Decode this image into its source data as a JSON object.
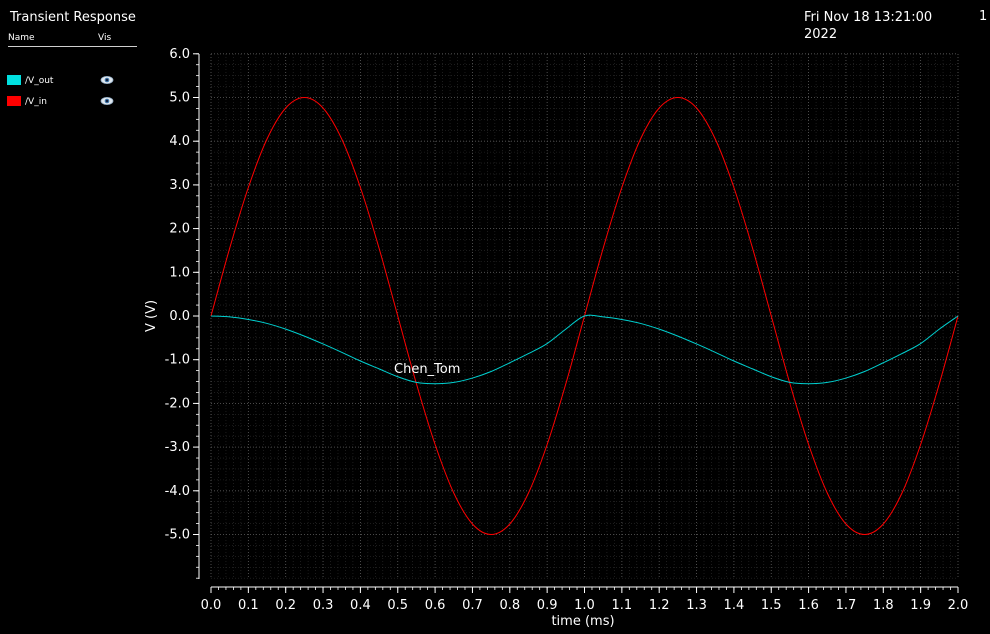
{
  "window": {
    "title": "Transient Response",
    "datetime": "Fri Nov 18 13:21:00 2022",
    "page_number": "1"
  },
  "legend": {
    "name_header": "Name",
    "vis_header": "Vis",
    "items": [
      {
        "label": "/V_out",
        "color": "#00e0e0",
        "eye_icon": "eye-icon"
      },
      {
        "label": "/V_in",
        "color": "#ff0000",
        "eye_icon": "eye-icon"
      }
    ]
  },
  "chart_data": {
    "type": "line",
    "title": "Transient Response",
    "xlabel": "time (ms)",
    "ylabel": "V (V)",
    "xlim": [
      0.0,
      2.0
    ],
    "ylim": [
      -6.0,
      6.0
    ],
    "x_ticks": [
      0.0,
      0.1,
      0.2,
      0.3,
      0.4,
      0.5,
      0.6,
      0.7,
      0.8,
      0.9,
      1.0,
      1.1,
      1.2,
      1.3,
      1.4,
      1.5,
      1.6,
      1.7,
      1.8,
      1.9,
      2.0
    ],
    "x_tick_labels": [
      "0.0",
      "0.1",
      "0.2",
      "0.3",
      "0.4",
      "0.5",
      "0.6",
      "0.7",
      "0.8",
      "0.9",
      "1.0",
      "1.1",
      "1.2",
      "1.3",
      "1.4",
      "1.5",
      "1.6",
      "1.7",
      "1.8",
      "1.9",
      "2.0"
    ],
    "y_ticks": [
      6.0,
      5.0,
      4.0,
      3.0,
      2.0,
      1.0,
      0.0,
      -1.0,
      -2.0,
      -3.0,
      -4.0,
      -5.0
    ],
    "y_tick_labels": [
      "6.0",
      "5.0",
      "4.0",
      "3.0",
      "2.0",
      "1.0",
      "0.0",
      "-1.0",
      "-2.0",
      "-3.0",
      "-4.0",
      "-5.0"
    ],
    "grid": true,
    "annotation": "Chen_Tom",
    "background": "#000000",
    "series": [
      {
        "name": "/V_in",
        "color": "#ff0000",
        "x": [
          0.0,
          0.05,
          0.1,
          0.15,
          0.2,
          0.25,
          0.3,
          0.35,
          0.4,
          0.45,
          0.5,
          0.55,
          0.6,
          0.65,
          0.7,
          0.75,
          0.8,
          0.85,
          0.9,
          0.95,
          1.0,
          1.05,
          1.1,
          1.15,
          1.2,
          1.25,
          1.3,
          1.35,
          1.4,
          1.45,
          1.5,
          1.55,
          1.6,
          1.65,
          1.7,
          1.75,
          1.8,
          1.85,
          1.9,
          1.95,
          2.0
        ],
        "values": [
          0.0,
          1.55,
          2.94,
          4.05,
          4.76,
          5.0,
          4.76,
          4.05,
          2.94,
          1.55,
          0.0,
          -1.55,
          -2.94,
          -4.05,
          -4.76,
          -5.0,
          -4.76,
          -4.05,
          -2.94,
          -1.55,
          0.0,
          1.55,
          2.94,
          4.05,
          4.76,
          5.0,
          4.76,
          4.05,
          2.94,
          1.55,
          0.0,
          -1.55,
          -2.94,
          -4.05,
          -4.76,
          -5.0,
          -4.76,
          -4.05,
          -2.94,
          -1.55,
          0.0
        ]
      },
      {
        "name": "/V_out",
        "color": "#00d0d0",
        "x": [
          0.0,
          0.05,
          0.1,
          0.15,
          0.2,
          0.25,
          0.3,
          0.35,
          0.4,
          0.45,
          0.5,
          0.55,
          0.6,
          0.65,
          0.7,
          0.75,
          0.8,
          0.85,
          0.9,
          0.95,
          1.0,
          1.05,
          1.1,
          1.15,
          1.2,
          1.25,
          1.3,
          1.35,
          1.4,
          1.45,
          1.5,
          1.55,
          1.6,
          1.65,
          1.7,
          1.75,
          1.8,
          1.85,
          1.9,
          1.95,
          2.0
        ],
        "values": [
          0.0,
          -0.02,
          -0.08,
          -0.17,
          -0.3,
          -0.46,
          -0.64,
          -0.83,
          -1.03,
          -1.21,
          -1.39,
          -1.52,
          -1.55,
          -1.52,
          -1.42,
          -1.27,
          -1.07,
          -0.86,
          -0.63,
          -0.3,
          0.0,
          -0.02,
          -0.08,
          -0.17,
          -0.3,
          -0.46,
          -0.64,
          -0.83,
          -1.03,
          -1.21,
          -1.39,
          -1.52,
          -1.55,
          -1.52,
          -1.42,
          -1.27,
          -1.07,
          -0.86,
          -0.63,
          -0.3,
          0.0
        ]
      }
    ]
  }
}
